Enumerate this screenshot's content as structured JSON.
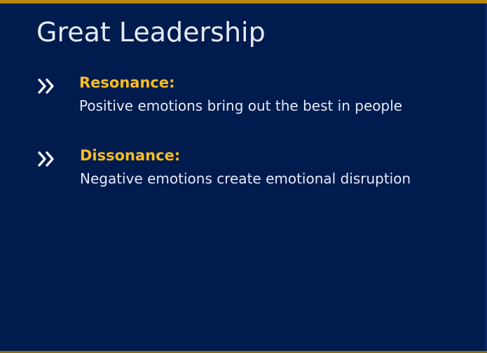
{
  "slide": {
    "title": "Great Leadership",
    "bullets": [
      {
        "icon": "double-chevron-right-icon",
        "term": "Resonance:",
        "description": "Positive emotions bring out the best in people"
      },
      {
        "icon": "double-chevron-right-icon",
        "term": "Dissonance:",
        "description": "Negative emotions create emotional disruption"
      }
    ]
  },
  "colors": {
    "background": "#001b4e",
    "accent_rule": "#b8870d",
    "term_text": "#f7bd21",
    "body_text": "#e6ebf5"
  }
}
